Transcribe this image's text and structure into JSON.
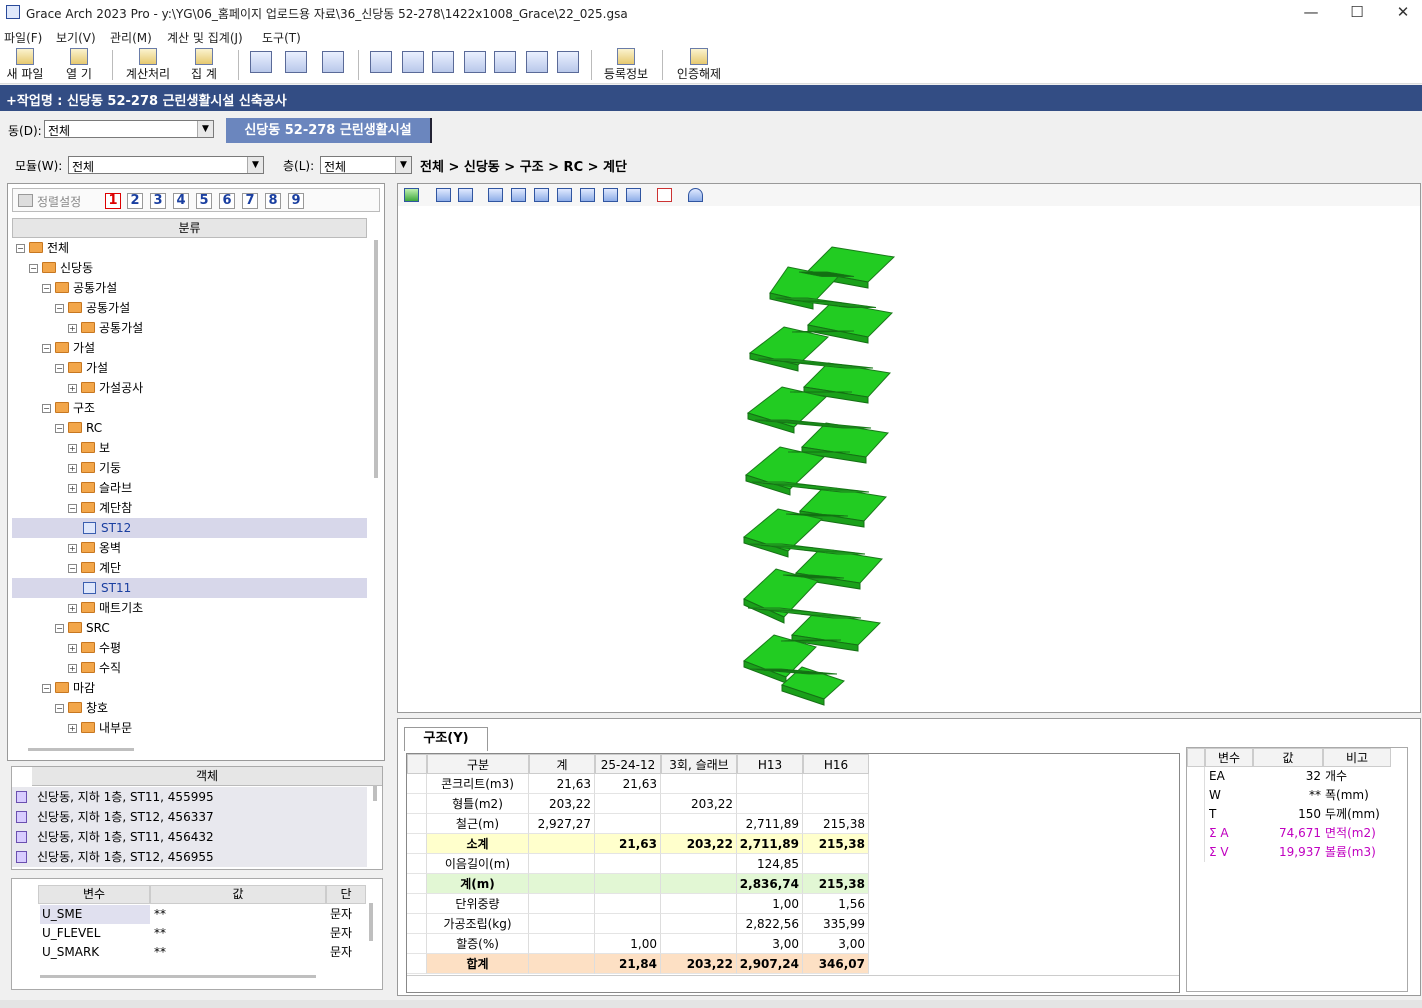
{
  "window": {
    "title": "Grace Arch 2023 Pro - y:\\YG\\06_홈페이지 업로드용 자료\\36_신당동 52-278\\1422x1008_Grace\\22_025.gsa",
    "minimize": "—",
    "maximize": "☐",
    "close": "✕"
  },
  "menu": [
    "파일(F)",
    "보기(V)",
    "관리(M)",
    "계산 및 집계(J)",
    "도구(T)"
  ],
  "toolbar": {
    "new_file": "새 파일",
    "open": "열   기",
    "calc": "계산처리",
    "summary": "집   계",
    "register": "등록정보",
    "unauth": "인증해제"
  },
  "project": {
    "banner": "+작업명 : 신당동 52-278 근린생활시설 신축공사",
    "dong_label": "동(D):",
    "dong_value": "전체",
    "dong_tab": "신당동  52-278  근린생활시설",
    "module_label": "모듈(W):",
    "module_value": "전체",
    "floor_label": "층(L):",
    "floor_value": "전체",
    "breadcrumb": "전체 > 신당동 > 구조 > RC > 계단"
  },
  "sortbar": {
    "label": "정렬설정",
    "numbers": [
      "1",
      "2",
      "3",
      "4",
      "5",
      "6",
      "7",
      "8",
      "9"
    ]
  },
  "tree": {
    "header": "분류",
    "items": [
      {
        "label": "전체",
        "depth": 0,
        "type": "folder",
        "box": "−"
      },
      {
        "label": "신당동",
        "depth": 1,
        "type": "folder",
        "box": "−"
      },
      {
        "label": "공통가설",
        "depth": 2,
        "type": "folder",
        "box": "−"
      },
      {
        "label": "공통가설",
        "depth": 3,
        "type": "folder",
        "box": "−"
      },
      {
        "label": "공통가설",
        "depth": 4,
        "type": "folder",
        "box": "+"
      },
      {
        "label": "가설",
        "depth": 2,
        "type": "folder",
        "box": "−"
      },
      {
        "label": "가설",
        "depth": 3,
        "type": "folder",
        "box": "−"
      },
      {
        "label": "가설공사",
        "depth": 4,
        "type": "folder",
        "box": "+"
      },
      {
        "label": "구조",
        "depth": 2,
        "type": "folder",
        "box": "−"
      },
      {
        "label": "RC",
        "depth": 3,
        "type": "folder",
        "box": "−"
      },
      {
        "label": "보",
        "depth": 4,
        "type": "folder",
        "box": "+"
      },
      {
        "label": "기둥",
        "depth": 4,
        "type": "folder",
        "box": "+"
      },
      {
        "label": "슬라브",
        "depth": 4,
        "type": "folder",
        "box": "+"
      },
      {
        "label": "계단참",
        "depth": 4,
        "type": "folder",
        "box": "−"
      },
      {
        "label": "ST12",
        "depth": 5,
        "type": "leaf",
        "box": "",
        "selected": true
      },
      {
        "label": "옹벽",
        "depth": 4,
        "type": "folder",
        "box": "+"
      },
      {
        "label": "계단",
        "depth": 4,
        "type": "folder",
        "box": "−"
      },
      {
        "label": "ST11",
        "depth": 5,
        "type": "leaf",
        "box": "",
        "selected": true
      },
      {
        "label": "매트기초",
        "depth": 4,
        "type": "folder",
        "box": "+"
      },
      {
        "label": "SRC",
        "depth": 3,
        "type": "folder",
        "box": "−"
      },
      {
        "label": "수평",
        "depth": 4,
        "type": "folder",
        "box": "+"
      },
      {
        "label": "수직",
        "depth": 4,
        "type": "folder",
        "box": "+"
      },
      {
        "label": "마감",
        "depth": 2,
        "type": "folder",
        "box": "−"
      },
      {
        "label": "창호",
        "depth": 3,
        "type": "folder",
        "box": "−"
      },
      {
        "label": "내부문",
        "depth": 4,
        "type": "folder",
        "box": "+"
      }
    ]
  },
  "objects": {
    "header": "객체",
    "rows": [
      "신당동, 지하 1층, ST11, 455995",
      "신당동, 지하 1층, ST12, 456337",
      "신당동, 지하 1층, ST11, 456432",
      "신당동, 지하 1층, ST12, 456955"
    ]
  },
  "variables": {
    "headers": [
      "변수",
      "값",
      "단"
    ],
    "rows": [
      {
        "name": "U_SME",
        "value": "**",
        "unit": "문자"
      },
      {
        "name": "U_FLEVEL",
        "value": "**",
        "unit": "문자"
      },
      {
        "name": "U_SMARK",
        "value": "**",
        "unit": "문자"
      }
    ]
  },
  "bottom_tab": "구조(Y)",
  "summary_table": {
    "headers": [
      "구분",
      "계",
      "25-24-12",
      "3회, 슬래브",
      "H13",
      "H16"
    ],
    "rows": [
      {
        "label": "콘크리트(m3)",
        "cells": [
          "21,63",
          "21,63",
          "",
          "",
          ""
        ],
        "style": "normal"
      },
      {
        "label": "형틀(m2)",
        "cells": [
          "203,22",
          "",
          "203,22",
          "",
          ""
        ],
        "style": "normal"
      },
      {
        "label": "철근(m)",
        "cells": [
          "2,927,27",
          "",
          "",
          "2,711,89",
          "215,38"
        ],
        "style": "normal"
      },
      {
        "label": "소계",
        "cells": [
          "",
          "21,63",
          "203,22",
          "2,711,89",
          "215,38"
        ],
        "style": "yellow"
      },
      {
        "label": "이음길이(m)",
        "cells": [
          "",
          "",
          "",
          "124,85",
          ""
        ],
        "style": "normal"
      },
      {
        "label": "계(m)",
        "cells": [
          "",
          "",
          "",
          "2,836,74",
          "215,38"
        ],
        "style": "green"
      },
      {
        "label": "단위중량",
        "cells": [
          "",
          "",
          "",
          "1,00",
          "1,56"
        ],
        "style": "normal"
      },
      {
        "label": "가공조립(kg)",
        "cells": [
          "",
          "",
          "",
          "2,822,56",
          "335,99"
        ],
        "style": "normal"
      },
      {
        "label": "할증(%)",
        "cells": [
          "",
          "1,00",
          "",
          "3,00",
          "3,00"
        ],
        "style": "normal"
      },
      {
        "label": "합계",
        "cells": [
          "",
          "21,84",
          "203,22",
          "2,907,24",
          "346,07"
        ],
        "style": "orange"
      }
    ]
  },
  "props_table": {
    "headers": [
      "변수",
      "값",
      "비고"
    ],
    "rows": [
      {
        "name": "EA",
        "value": "32",
        "note": "개수",
        "highlight": false
      },
      {
        "name": "W",
        "value": "**",
        "note": "폭(mm)",
        "highlight": false
      },
      {
        "name": "T",
        "value": "150",
        "note": "두께(mm)",
        "highlight": false
      },
      {
        "name": "Σ A",
        "value": "74,671",
        "note": "면적(m2)",
        "highlight": true
      },
      {
        "name": "Σ V",
        "value": "19,937",
        "note": "볼륨(m3)",
        "highlight": true
      }
    ]
  },
  "colors": {
    "banner": "#334d84",
    "tab": "#6b86be",
    "stair_green": "#22cc22",
    "row_yellow": "#ffffcc",
    "row_green": "#e2f7d4",
    "row_orange": "#fde0c4",
    "highlight_magenta": "#c000c0"
  }
}
